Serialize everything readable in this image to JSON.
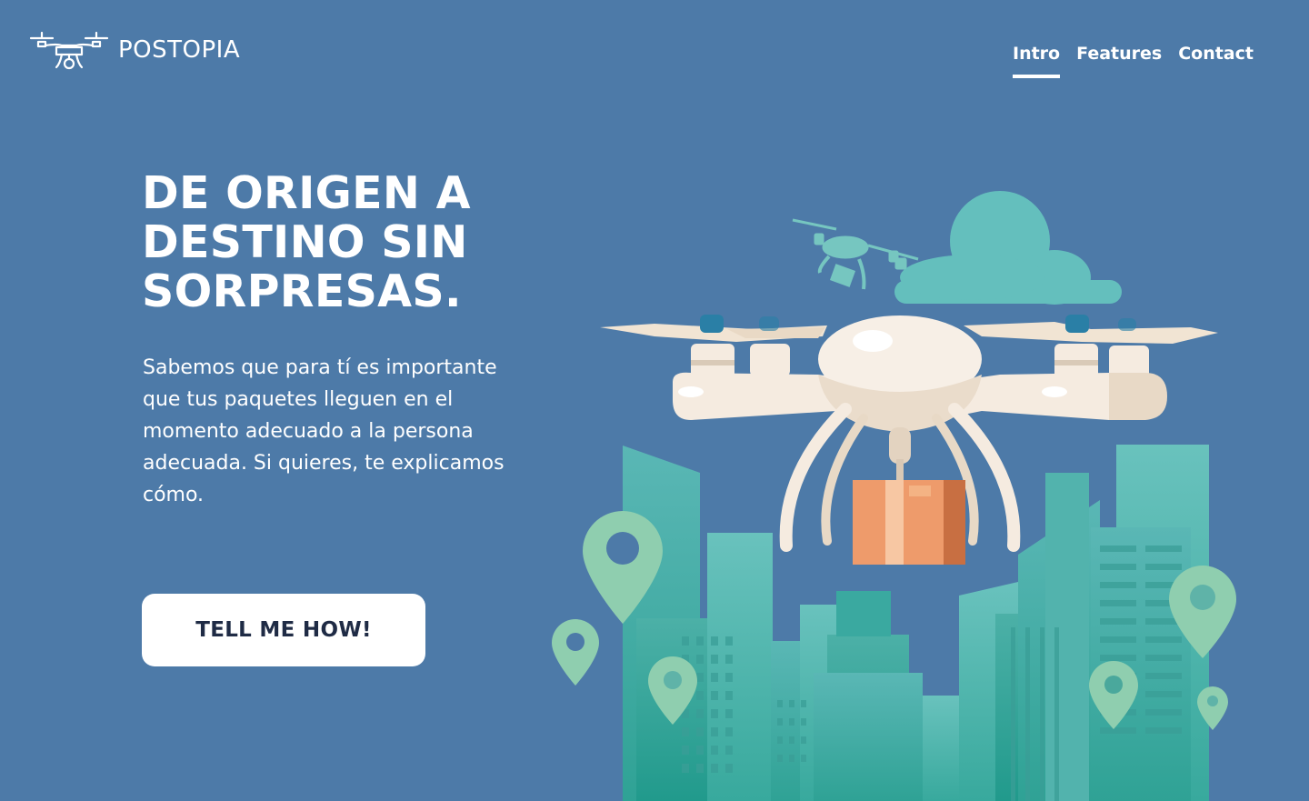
{
  "header": {
    "brand": "POSTOPIA",
    "logo_icon": "drone-icon",
    "nav": [
      {
        "label": "Intro",
        "active": true
      },
      {
        "label": "Features",
        "active": false
      },
      {
        "label": "Contact",
        "active": false
      }
    ]
  },
  "hero": {
    "headline": "DE ORIGEN A DESTINO SIN SORPRESAS.",
    "body": "Sabemos que para tí es importante que tus paquetes lleguen en el momento adecuado a la persona adecuada. Si quieres, te explicamos cómo.",
    "cta_label": "TELL ME HOW!"
  },
  "illustration": {
    "description_icon": "delivery-drone-city-illustration"
  },
  "colors": {
    "background": "#4d7aa8",
    "accent": "#5fbfb0",
    "button_text": "#1f2b45",
    "package": "#ee9b6b",
    "drone_body": "#f5ebe0"
  }
}
